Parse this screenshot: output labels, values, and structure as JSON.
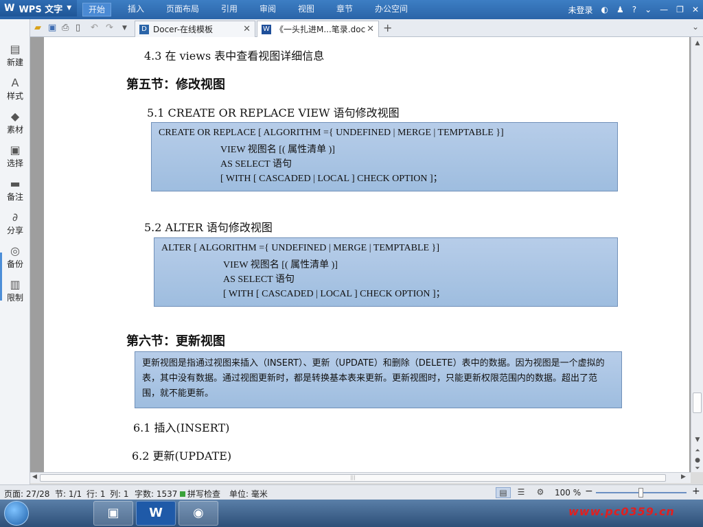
{
  "app": {
    "name": "WPS 文字",
    "menu": [
      "开始",
      "插入",
      "页面布局",
      "引用",
      "审阅",
      "视图",
      "章节",
      "办公空间"
    ],
    "login": "未登录",
    "help": "?"
  },
  "tabs": [
    {
      "label": "Docer-在线模板",
      "icon": "docer-icon"
    },
    {
      "label": "《一头扎进M...笔录.doc",
      "icon": "word-doc-icon"
    }
  ],
  "sidebar": [
    {
      "label": "新建",
      "icon": "new-doc-icon",
      "glyph": "▤"
    },
    {
      "label": "样式",
      "icon": "style-icon",
      "glyph": "A"
    },
    {
      "label": "素材",
      "icon": "material-icon",
      "glyph": "◆"
    },
    {
      "label": "选择",
      "icon": "select-icon",
      "glyph": "▣"
    },
    {
      "label": "备注",
      "icon": "note-icon",
      "glyph": "▬"
    },
    {
      "label": "分享",
      "icon": "share-icon",
      "glyph": "∂"
    },
    {
      "label": "备份",
      "icon": "backup-icon",
      "glyph": "◎"
    },
    {
      "label": "限制",
      "icon": "restrict-icon",
      "glyph": "▥"
    }
  ],
  "document": {
    "s43_heading": "4.3  在 views 表中查看视图详细信息",
    "sec5_title": "第五节：修改视图",
    "s51_heading": "5.1    CREATE OR REPLACE VIEW  语句修改视图",
    "code1": [
      "CREATE OR REPLACE [ ALGORITHM ={ UNDEFINED | MERGE | TEMPTABLE }]",
      "VIEW  视图名  [(  属性清单  )]",
      "AS SELECT  语句",
      "[ WITH [ CASCADED | LOCAL ] CHECK OPTION ]；"
    ],
    "s52_heading": "5.2    ALTER  语句修改视图",
    "code2": [
      "ALTER    [ ALGORITHM ={ UNDEFINED | MERGE | TEMPTABLE }]",
      "VIEW  视图名  [(  属性清单  )]",
      "AS SELECT  语句",
      "[ WITH [ CASCADED | LOCAL ] CHECK OPTION ]；"
    ],
    "sec6_title": "第六节：更新视图",
    "para6": "更新视图是指通过视图来插入（INSERT）、更新（UPDATE）和删除（DELETE）表中的数据。因为视图是一个虚拟的表，其中没有数据。通过视图更新时，都是转换基本表来更新。更新视图时，只能更新权限范围内的数据。超出了范围，就不能更新。",
    "s61_heading": "6.1  插入(INSERT)",
    "s62_heading": "6.2  更新(UPDATE)"
  },
  "status": {
    "page": "页面: 27/28",
    "section": "节: 1/1",
    "row": "行: 1",
    "col": "列: 1",
    "words": "字数: 1537",
    "spell": "拼写检查",
    "unit": "单位: 毫米",
    "zoom": "100 %",
    "zoom_level": 0.5
  },
  "taskbar": {
    "watermark": "www.pc0359.cn",
    "wps_glyph": "W"
  },
  "colors": {
    "accent": "#2a64a8",
    "code_box": "#a9c4e4",
    "watermark": "#e02020"
  }
}
